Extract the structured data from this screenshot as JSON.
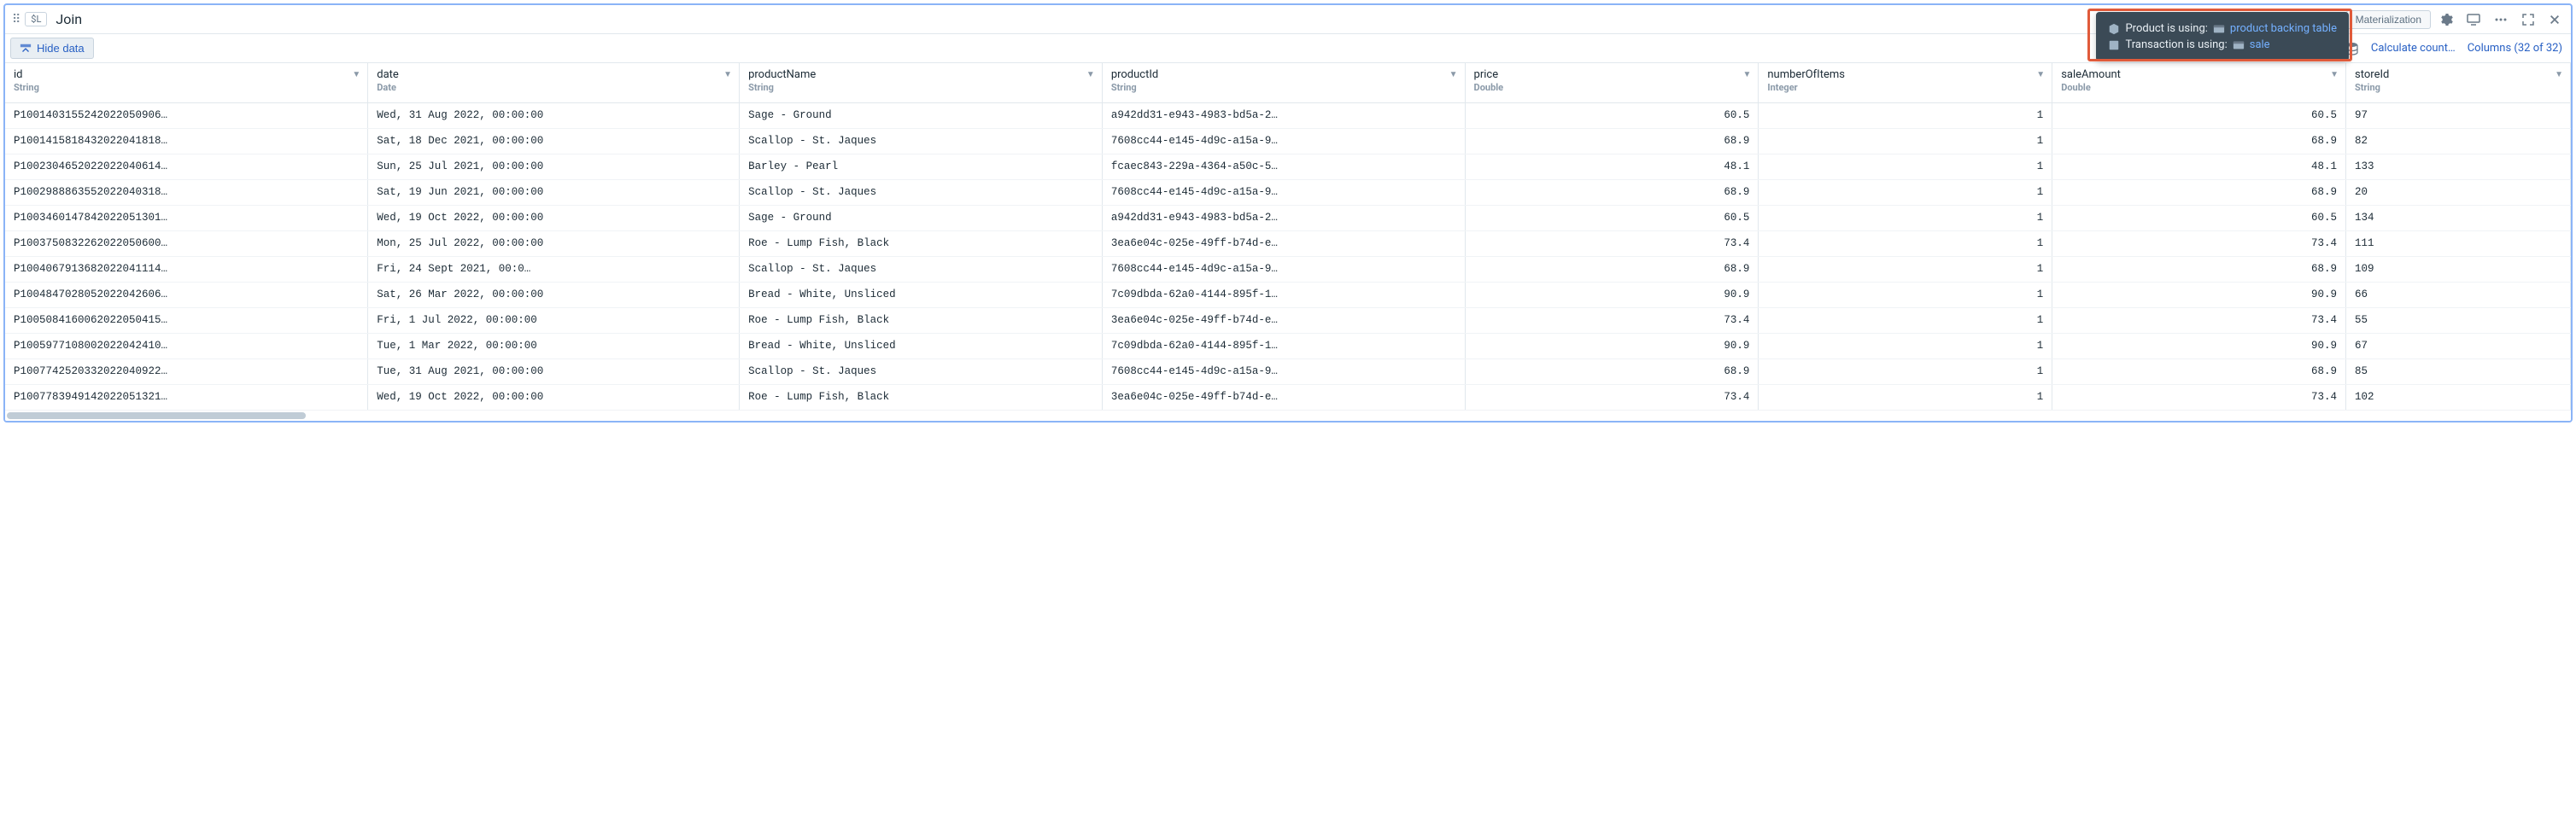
{
  "header": {
    "sl_badge": "$L",
    "title": "Join",
    "materialization": "Materialization"
  },
  "subbar": {
    "hide_data": "Hide data",
    "calculate": "Calculate count…",
    "columns": "Columns (32 of 32)"
  },
  "tooltip": {
    "product_label": "Product is using:",
    "product_link": "product backing table",
    "transaction_label": "Transaction is using:",
    "transaction_link": "sale"
  },
  "columns": [
    {
      "name": "id",
      "type": "String",
      "class": "col-id"
    },
    {
      "name": "date",
      "type": "Date",
      "class": "col-date"
    },
    {
      "name": "productName",
      "type": "String",
      "class": "col-pname"
    },
    {
      "name": "productId",
      "type": "String",
      "class": "col-pid"
    },
    {
      "name": "price",
      "type": "Double",
      "class": "col-price",
      "num": true
    },
    {
      "name": "numberOfItems",
      "type": "Integer",
      "class": "col-items",
      "num": true
    },
    {
      "name": "saleAmount",
      "type": "Double",
      "class": "col-sale",
      "num": true
    },
    {
      "name": "storeId",
      "type": "String",
      "class": "col-store"
    }
  ],
  "rows": [
    [
      "P1001403155242022050906…",
      "Wed, 31 Aug 2022, 00:00:00",
      "Sage - Ground",
      "a942dd31-e943-4983-bd5a-2…",
      "60.5",
      "1",
      "60.5",
      "97"
    ],
    [
      "P1001415818432022041818…",
      "Sat, 18 Dec 2021, 00:00:00",
      "Scallop - St. Jaques",
      "7608cc44-e145-4d9c-a15a-9…",
      "68.9",
      "1",
      "68.9",
      "82"
    ],
    [
      "P1002304652022022040614…",
      "Sun, 25 Jul 2021, 00:00:00",
      "Barley - Pearl",
      "fcaec843-229a-4364-a50c-5…",
      "48.1",
      "1",
      "48.1",
      "133"
    ],
    [
      "P1002988863552022040318…",
      "Sat, 19 Jun 2021, 00:00:00",
      "Scallop - St. Jaques",
      "7608cc44-e145-4d9c-a15a-9…",
      "68.9",
      "1",
      "68.9",
      "20"
    ],
    [
      "P1003460147842022051301…",
      "Wed, 19 Oct 2022, 00:00:00",
      "Sage - Ground",
      "a942dd31-e943-4983-bd5a-2…",
      "60.5",
      "1",
      "60.5",
      "134"
    ],
    [
      "P1003750832262022050600…",
      "Mon, 25 Jul 2022, 00:00:00",
      "Roe - Lump Fish, Black",
      "3ea6e04c-025e-49ff-b74d-e…",
      "73.4",
      "1",
      "73.4",
      "111"
    ],
    [
      "P1004067913682022041114…",
      "Fri, 24 Sept 2021, 00:0…",
      "Scallop - St. Jaques",
      "7608cc44-e145-4d9c-a15a-9…",
      "68.9",
      "1",
      "68.9",
      "109"
    ],
    [
      "P1004847028052022042606…",
      "Sat, 26 Mar 2022, 00:00:00",
      "Bread - White, Unsliced",
      "7c09dbda-62a0-4144-895f-1…",
      "90.9",
      "1",
      "90.9",
      "66"
    ],
    [
      "P1005084160062022050415…",
      "Fri, 1 Jul 2022, 00:00:00",
      "Roe - Lump Fish, Black",
      "3ea6e04c-025e-49ff-b74d-e…",
      "73.4",
      "1",
      "73.4",
      "55"
    ],
    [
      "P1005977108002022042410…",
      "Tue, 1 Mar 2022, 00:00:00",
      "Bread - White, Unsliced",
      "7c09dbda-62a0-4144-895f-1…",
      "90.9",
      "1",
      "90.9",
      "67"
    ],
    [
      "P1007742520332022040922…",
      "Tue, 31 Aug 2021, 00:00:00",
      "Scallop - St. Jaques",
      "7608cc44-e145-4d9c-a15a-9…",
      "68.9",
      "1",
      "68.9",
      "85"
    ],
    [
      "P1007783949142022051321…",
      "Wed, 19 Oct 2022, 00:00:00",
      "Roe - Lump Fish, Black",
      "3ea6e04c-025e-49ff-b74d-e…",
      "73.4",
      "1",
      "73.4",
      "102"
    ]
  ]
}
